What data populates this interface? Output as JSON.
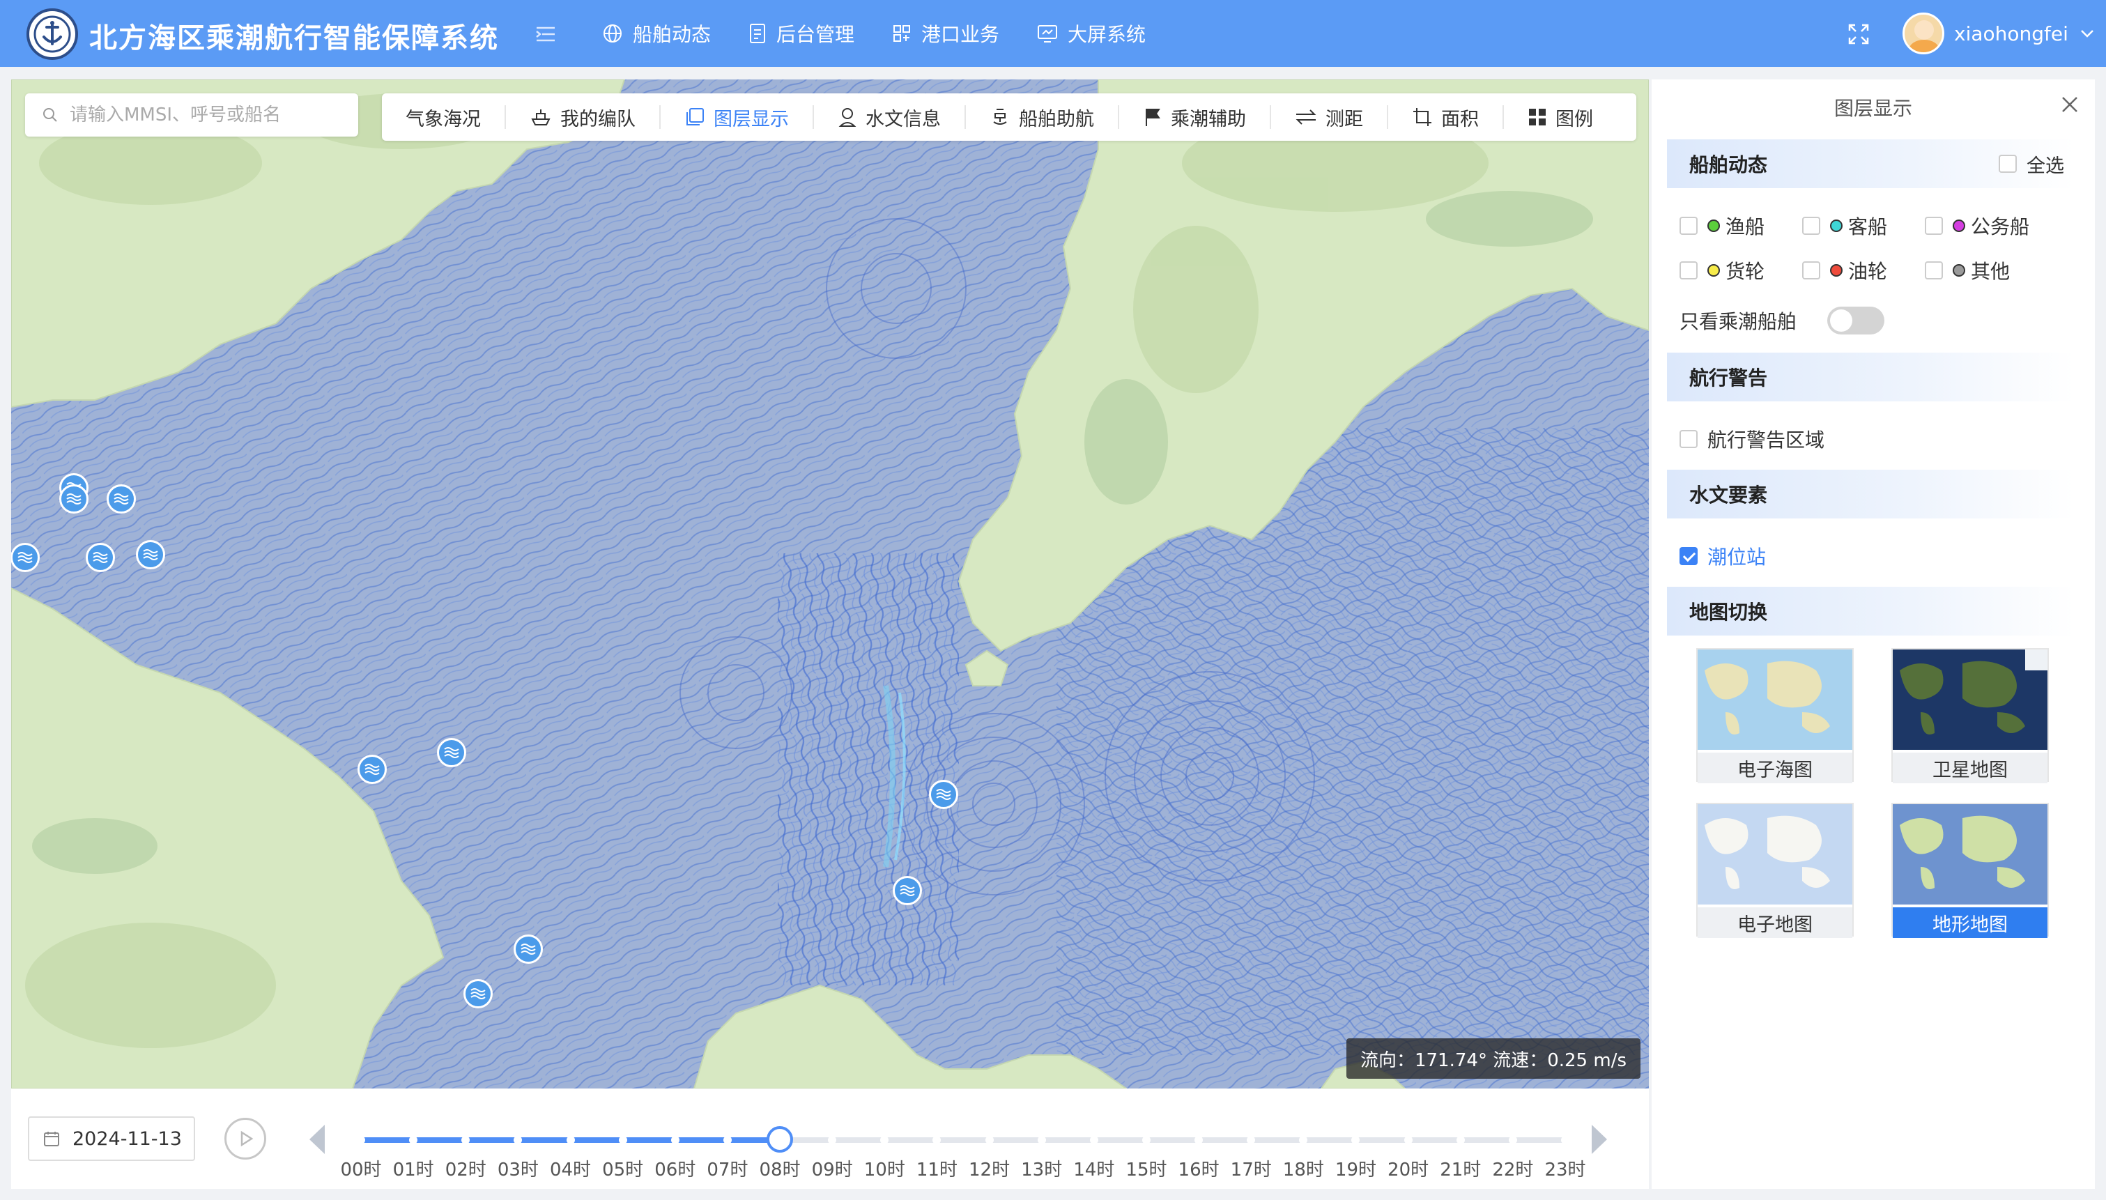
{
  "header": {
    "title": "北方海区乘潮航行智能保障系统",
    "nav": [
      {
        "label": "船舶动态",
        "icon": "globe-icon"
      },
      {
        "label": "后台管理",
        "icon": "document-icon"
      },
      {
        "label": "港口业务",
        "icon": "grid-icon"
      },
      {
        "label": "大屏系统",
        "icon": "monitor-icon"
      }
    ],
    "username": "xiaohongfei"
  },
  "search": {
    "placeholder": "请输入MMSI、呼号或船名"
  },
  "toolbar": [
    {
      "label": "气象海况",
      "icon": "",
      "active": false
    },
    {
      "label": "我的编队",
      "icon": "ship-icon",
      "active": false
    },
    {
      "label": "图层显示",
      "icon": "layers-icon",
      "active": true
    },
    {
      "label": "水文信息",
      "icon": "person-pin-icon",
      "active": false
    },
    {
      "label": "船舶助航",
      "icon": "buoy-icon",
      "active": false
    },
    {
      "label": "乘潮辅助",
      "icon": "flag-icon",
      "active": false
    },
    {
      "label": "测距",
      "icon": "ruler-icon",
      "active": false
    },
    {
      "label": "面积",
      "icon": "crop-icon",
      "active": false
    },
    {
      "label": "图例",
      "icon": "legend-icon",
      "active": false
    }
  ],
  "map": {
    "readout": "流向：171.74° 流速：0.25 m/s",
    "colors": {
      "sea": "#9fb2d6",
      "land": "#d7e8c2",
      "flow": "#3f6fd4",
      "station": "#4b9bea"
    }
  },
  "timeline": {
    "date": "2024-11-13",
    "hours": [
      "00时",
      "01时",
      "02时",
      "03时",
      "04时",
      "05时",
      "06时",
      "07时",
      "08时",
      "09时",
      "10时",
      "11时",
      "12时",
      "13时",
      "14时",
      "15时",
      "16时",
      "17时",
      "18时",
      "19时",
      "20时",
      "21时",
      "22时",
      "23时"
    ],
    "current_index": 8
  },
  "panel": {
    "title": "图层显示",
    "sections": {
      "ship": {
        "title": "船舶动态",
        "select_all": "全选",
        "types": [
          {
            "label": "渔船",
            "color": "#5ccf3c"
          },
          {
            "label": "客船",
            "color": "#3fd6d6"
          },
          {
            "label": "公务船",
            "color": "#d43ee0"
          },
          {
            "label": "货轮",
            "color": "#f7ec4a"
          },
          {
            "label": "油轮",
            "color": "#ef4b3c"
          },
          {
            "label": "其他",
            "color": "#9a9a9a"
          }
        ],
        "tide_only_label": "只看乘潮船舶"
      },
      "warning": {
        "title": "航行警告",
        "area_label": "航行警告区域"
      },
      "hydro": {
        "title": "水文要素",
        "tide_station_label": "潮位站"
      },
      "basemap": {
        "title": "地图切换",
        "options": [
          {
            "label": "电子海图",
            "active": false
          },
          {
            "label": "卫星地图",
            "active": false
          },
          {
            "label": "电子地图",
            "active": false
          },
          {
            "label": "地形地图",
            "active": true
          }
        ]
      }
    }
  }
}
